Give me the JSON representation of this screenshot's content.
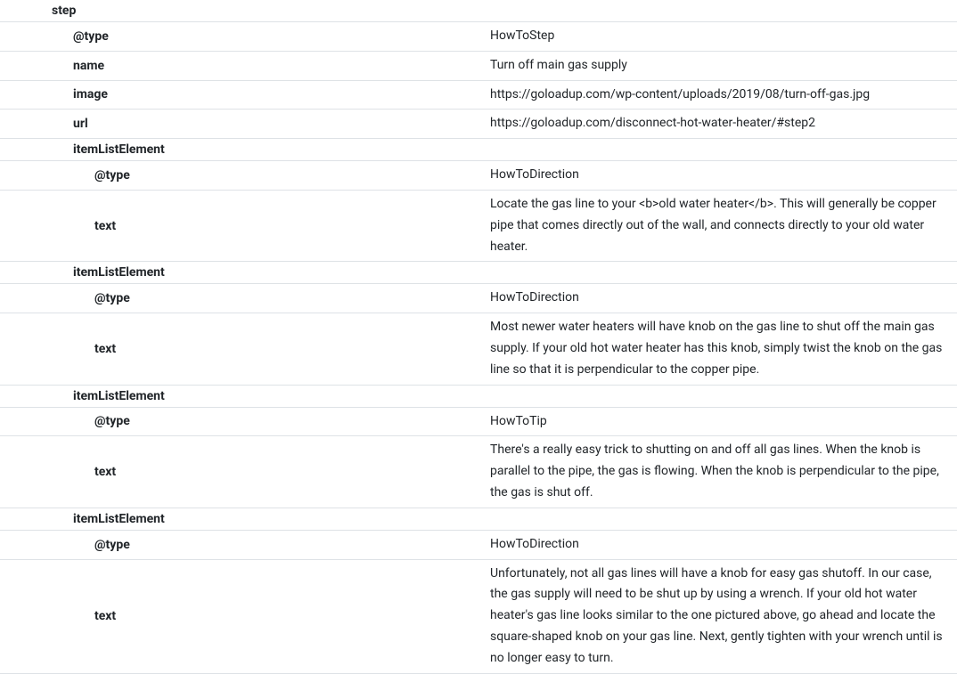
{
  "labels": {
    "step": "step",
    "type": "@type",
    "name": "name",
    "image": "image",
    "url": "url",
    "itemListElement": "itemListElement",
    "text": "text"
  },
  "step": {
    "type": "HowToStep",
    "name": "Turn off main gas supply",
    "image": "https://goloadup.com/wp-content/uploads/2019/08/turn-off-gas.jpg",
    "url": "https://goloadup.com/disconnect-hot-water-heater/#step2",
    "items": [
      {
        "type": "HowToDirection",
        "text": "Locate the gas line to your <b>old water heater</b>. This will generally be copper pipe that comes directly out of the wall, and connects directly to your old water heater."
      },
      {
        "type": "HowToDirection",
        "text": "Most newer water heaters will have knob on the gas line to shut off the main gas supply. If your old hot water heater has this knob, simply twist the knob on the gas line so that it is perpendicular to the copper pipe."
      },
      {
        "type": "HowToTip",
        "text": "There's a really easy trick to shutting on and off all gas lines. When the knob is parallel to the pipe, the gas is flowing. When the knob is perpendicular to the pipe, the gas is shut off."
      },
      {
        "type": "HowToDirection",
        "text": "Unfortunately, not all gas lines will have a knob for easy gas shutoff. In our case, the gas supply will need to be shut up by using a wrench. If your old hot water heater's gas line looks similar to the one pictured above, go ahead and locate the square-shaped knob on your gas line. Next, gently tighten with your wrench until is no longer easy to turn."
      }
    ]
  }
}
